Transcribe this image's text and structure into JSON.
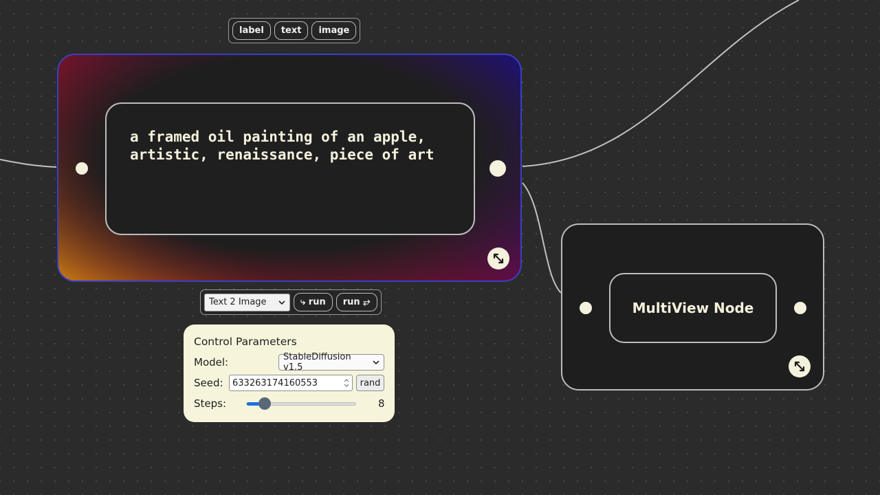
{
  "top_toolbar": {
    "items": [
      "label",
      "text",
      "image"
    ]
  },
  "text_node": {
    "text": "a framed oil painting of an apple,\nartistic, renaissance, piece of art",
    "gradient_colors": [
      "#e38b10",
      "#c0102a",
      "#7a0a40",
      "#1a0aa8"
    ],
    "border_color": "#3a3fc6"
  },
  "run_toolbar": {
    "mode_select": "Text 2 Image",
    "run_label": "⤷ run",
    "run_chain_label": "run ⥂"
  },
  "params": {
    "title": "Control Parameters",
    "model_label": "Model:",
    "model_value": "StableDiffusion v1.5",
    "seed_label": "Seed:",
    "seed_value": "633263174160553",
    "rand_label": "rand",
    "steps_label": "Steps:",
    "steps_value": "8",
    "steps_fraction": 0.16
  },
  "multiview_node": {
    "title": "MultiView Node"
  },
  "colors": {
    "background": "#2b2b2b",
    "node_fill": "#1e1e1e",
    "port": "#f4f1dc",
    "panel": "#f6f5dc",
    "slider_accent": "#1d6fe0"
  },
  "icons": [
    "expand-icon",
    "chevron-down-icon",
    "spinner-icon"
  ]
}
